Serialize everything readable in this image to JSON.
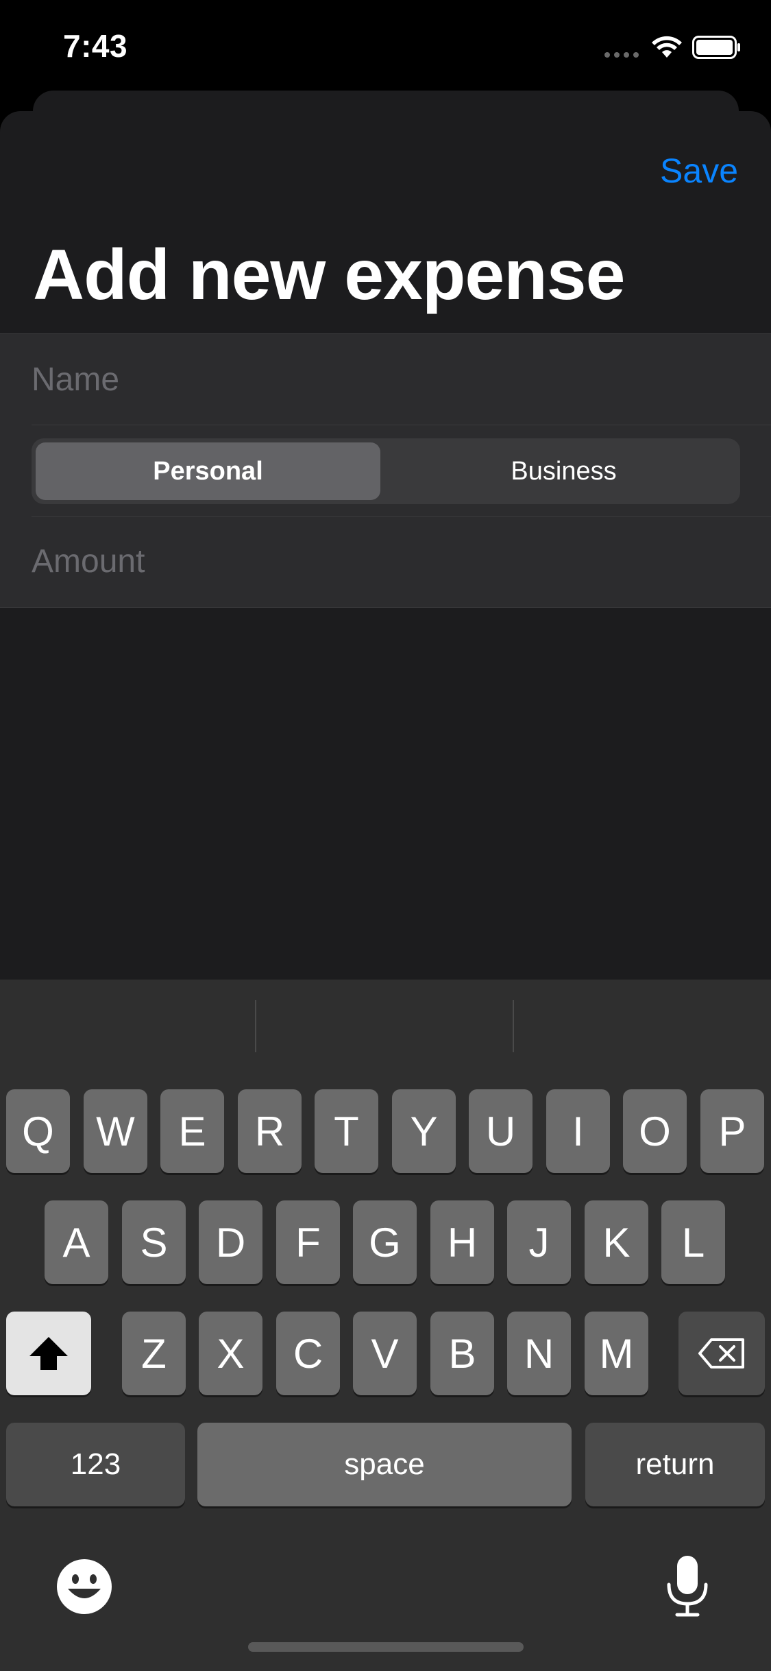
{
  "status_bar": {
    "time": "7:43"
  },
  "header": {
    "save_label": "Save",
    "title": "Add new expense"
  },
  "form": {
    "name_placeholder": "Name",
    "name_value": "",
    "type_options": [
      "Personal",
      "Business"
    ],
    "type_selected": "Personal",
    "amount_placeholder": "Amount",
    "amount_value": ""
  },
  "keyboard": {
    "row1": [
      "Q",
      "W",
      "E",
      "R",
      "T",
      "Y",
      "U",
      "I",
      "O",
      "P"
    ],
    "row2": [
      "A",
      "S",
      "D",
      "F",
      "G",
      "H",
      "J",
      "K",
      "L"
    ],
    "row3": [
      "Z",
      "X",
      "C",
      "V",
      "B",
      "N",
      "M"
    ],
    "numbers_label": "123",
    "space_label": "space",
    "return_label": "return",
    "icons": {
      "shift": "shift-icon",
      "delete": "delete-icon",
      "emoji": "emoji-icon",
      "dictation": "microphone-icon"
    }
  },
  "colors": {
    "accent": "#0a84ff",
    "background": "#1c1c1e",
    "group": "#2c2c2e"
  }
}
